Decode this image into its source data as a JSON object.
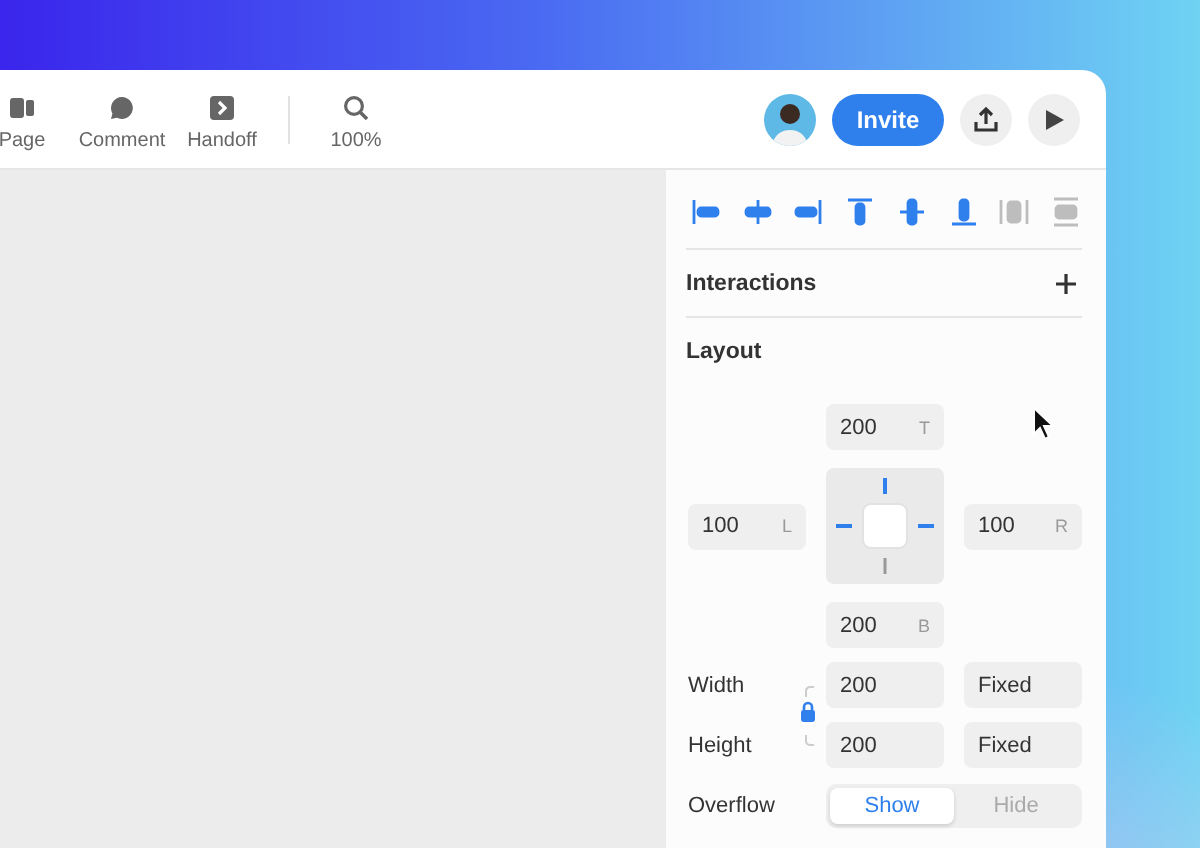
{
  "toolbar": {
    "tools": [
      {
        "kind": "page",
        "label": "Page"
      },
      {
        "kind": "comment",
        "label": "Comment"
      },
      {
        "kind": "handoff",
        "label": "Handoff"
      },
      {
        "kind": "zoom",
        "label": "100%"
      }
    ],
    "invite": "Invite"
  },
  "align_tools": [
    {
      "kind": "left",
      "disabled": false
    },
    {
      "kind": "hcenter",
      "disabled": false
    },
    {
      "kind": "right",
      "disabled": false
    },
    {
      "kind": "top",
      "disabled": false
    },
    {
      "kind": "vcenter",
      "disabled": false
    },
    {
      "kind": "bottom",
      "disabled": false
    },
    {
      "kind": "hdistribute",
      "disabled": true
    },
    {
      "kind": "vdistribute",
      "disabled": true
    }
  ],
  "interactions": {
    "title": "Interactions"
  },
  "layout": {
    "title": "Layout",
    "spacing": {
      "top": {
        "value": "200",
        "side": "T"
      },
      "left": {
        "value": "100",
        "side": "L"
      },
      "right": {
        "value": "100",
        "side": "R"
      },
      "bottom": {
        "value": "200",
        "side": "B"
      }
    },
    "aspect_locked": true,
    "size": [
      {
        "label": "Width",
        "value": "200",
        "mode": "Fixed"
      },
      {
        "label": "Height",
        "value": "200",
        "mode": "Fixed"
      }
    ],
    "overflow": {
      "label": "Overflow",
      "options": [
        {
          "label": "Show",
          "selected": true
        },
        {
          "label": "Hide",
          "selected": false
        }
      ]
    }
  }
}
